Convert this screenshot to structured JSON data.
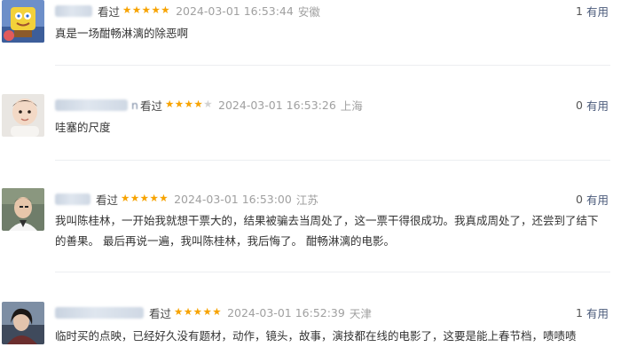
{
  "comments": [
    {
      "username_tail": "",
      "watched": "看过",
      "stars": 5,
      "time": "2024-03-01 16:53:44",
      "location": "安徽",
      "useful_count": "1",
      "useful_label": "有用",
      "content": "真是一场酣畅淋漓的除恶啊"
    },
    {
      "username_tail": "n",
      "watched": "看过",
      "stars": 4,
      "time": "2024-03-01 16:53:26",
      "location": "上海",
      "useful_count": "0",
      "useful_label": "有用",
      "content": "哇塞的尺度"
    },
    {
      "username_tail": "",
      "watched": "看过",
      "stars": 5,
      "time": "2024-03-01 16:53:00",
      "location": "江苏",
      "useful_count": "0",
      "useful_label": "有用",
      "content": "我叫陈桂林，一开始我就想干票大的，结果被骗去当周处了，这一票干得很成功。我真成周处了，还尝到了结下的善果。 最后再说一遍，我叫陈桂林，我后悔了。 酣畅淋漓的电影。"
    },
    {
      "username_tail": "",
      "watched": "看过",
      "stars": 5,
      "time": "2024-03-01 16:52:39",
      "location": "天津",
      "useful_count": "1",
      "useful_label": "有用",
      "content": "临时买的点映，已经好久没有题材，动作，镜头，故事，演技都在线的电影了，这要是能上春节档，啧啧啧"
    }
  ]
}
